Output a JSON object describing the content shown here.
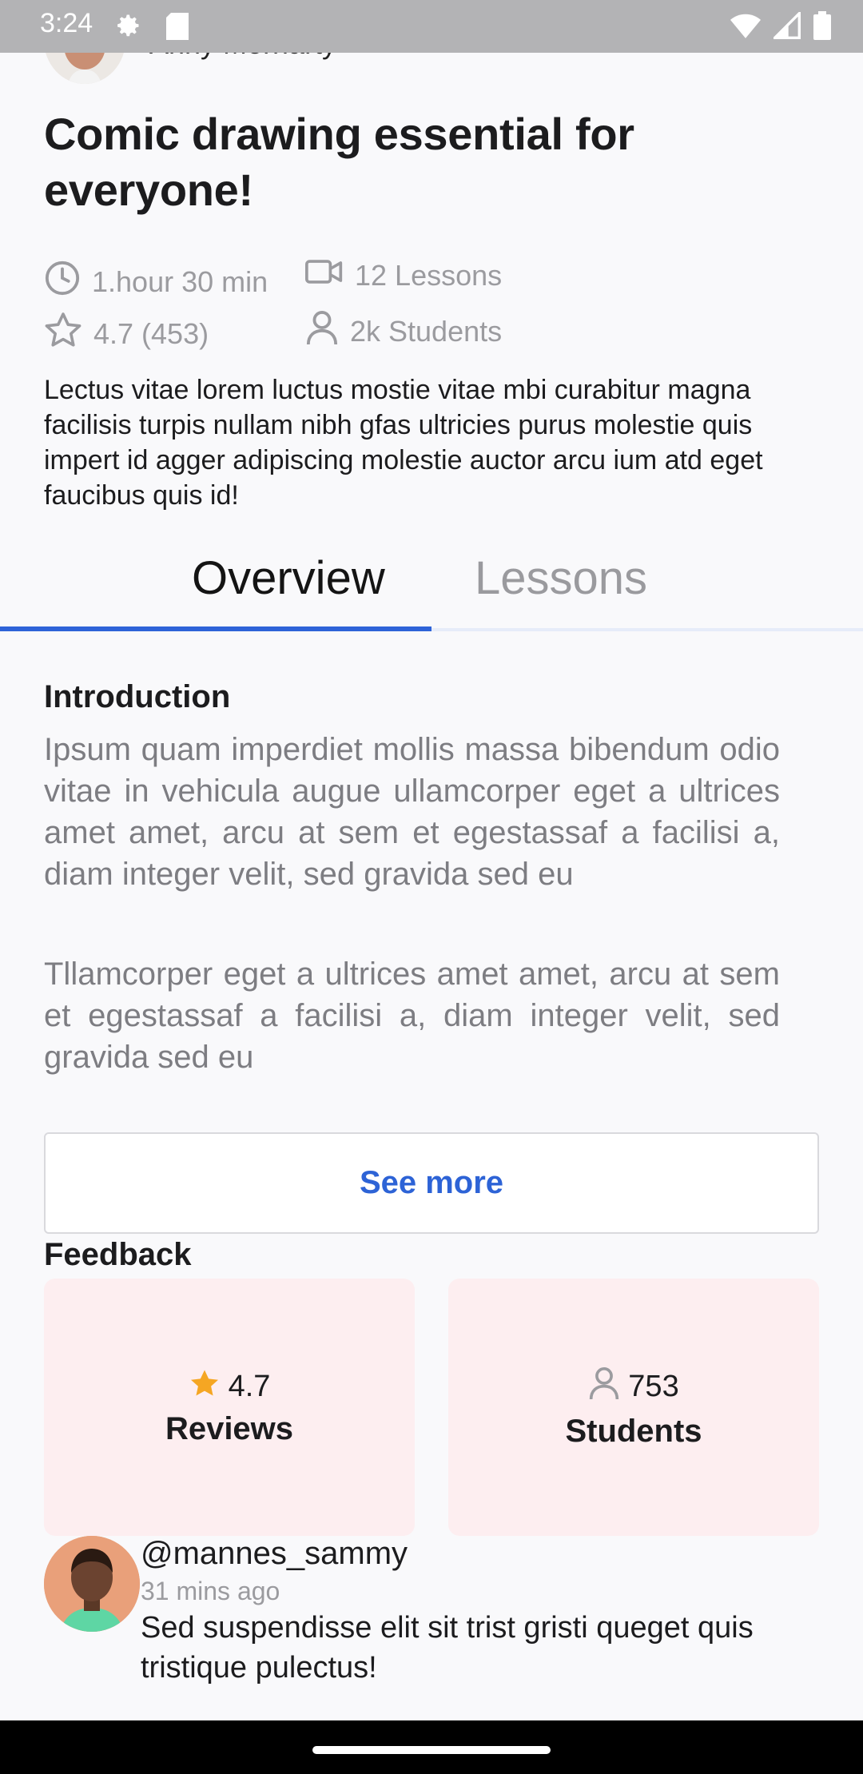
{
  "status_bar": {
    "time": "3:24"
  },
  "author": {
    "name": "Anny Morriarty"
  },
  "course": {
    "title": "Comic drawing essential for everyone!",
    "duration": "1.hour 30 min",
    "lessons": "12 Lessons",
    "rating": "4.7 (453)",
    "students": "2k Students",
    "description": "Lectus vitae lorem luctus mostie vitae mbi curabitur magna facilisis turpis nullam nibh gfas ultricies purus molestie quis impert id agger adipiscing molestie auctor arcu ium  atd eget faucibus quis id!"
  },
  "tabs": [
    {
      "label": "Overview",
      "active": true
    },
    {
      "label": "Lessons",
      "active": false
    }
  ],
  "overview": {
    "heading": "Introduction",
    "paragraphs": [
      "Ipsum quam imperdiet mollis massa bibendum odio vitae in vehicula augue ullamcorper eget a ultrices amet amet, arcu at sem et egestassaf a  facilisi a, diam integer velit, sed gravida sed eu",
      "Tllamcorper eget a ultrices amet amet, arcu at sem et egestassaf a  facilisi a, diam integer velit, sed gravida sed eu"
    ],
    "see_more_label": "See more"
  },
  "feedback": {
    "heading": "Feedback",
    "cards": [
      {
        "value": "4.7",
        "label": "Reviews",
        "icon": "star-icon"
      },
      {
        "value": "753",
        "label": "Students",
        "icon": "person-icon"
      }
    ]
  },
  "comment": {
    "username": "@mannes_sammy",
    "time": "31 mins ago",
    "text": "Sed suspendisse elit sit trist gristi queget quis tristique pulectus!"
  },
  "colors": {
    "accent": "#2e63d8",
    "card_bg": "#fdeef0",
    "star": "#f5a623",
    "muted_text": "#9b9b9f"
  }
}
